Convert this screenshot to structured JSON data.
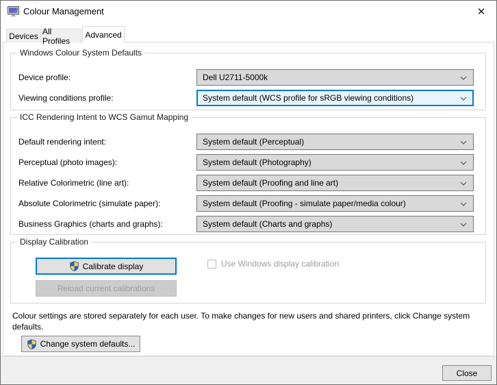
{
  "window": {
    "title": "Colour Management",
    "close_glyph": "✕"
  },
  "tabs": [
    {
      "label": "Devices",
      "selected": false
    },
    {
      "label": "All Profiles",
      "selected": false
    },
    {
      "label": "Advanced",
      "selected": true
    }
  ],
  "groups": {
    "wcs_defaults": {
      "title": "Windows Colour System Defaults",
      "rows": [
        {
          "label": "Device profile:",
          "value": "Dell U2711-5000k",
          "focused": false
        },
        {
          "label": "Viewing conditions profile:",
          "value": "System default (WCS profile for sRGB viewing conditions)",
          "focused": true
        }
      ]
    },
    "icc_mapping": {
      "title": "ICC Rendering Intent to WCS Gamut Mapping",
      "rows": [
        {
          "label": "Default rendering intent:",
          "value": "System default (Perceptual)"
        },
        {
          "label": "Perceptual (photo images):",
          "value": "System default (Photography)"
        },
        {
          "label": "Relative Colorimetric (line art):",
          "value": "System default (Proofing and line art)"
        },
        {
          "label": "Absolute Colorimetric (simulate paper):",
          "value": "System default (Proofing - simulate paper/media colour)"
        },
        {
          "label": "Business Graphics (charts and graphs):",
          "value": "System default (Charts and graphs)"
        }
      ]
    },
    "display_calibration": {
      "title": "Display Calibration",
      "calibrate_button": "Calibrate display",
      "reload_button": "Reload current calibrations",
      "checkbox_label": "Use Windows display calibration",
      "checkbox_checked": false
    }
  },
  "footer_note": "Colour settings are stored separately for each user. To make changes for new users and shared printers, click Change system defaults.",
  "change_defaults_button": "Change system defaults...",
  "close_button": "Close",
  "colors": {
    "accent": "#0078d7",
    "focused_combo_fill": "#e9f3fd",
    "combo_fill": "#d9d9d9",
    "shield_blue": "#2f5fbf",
    "shield_yellow": "#f6d342"
  }
}
